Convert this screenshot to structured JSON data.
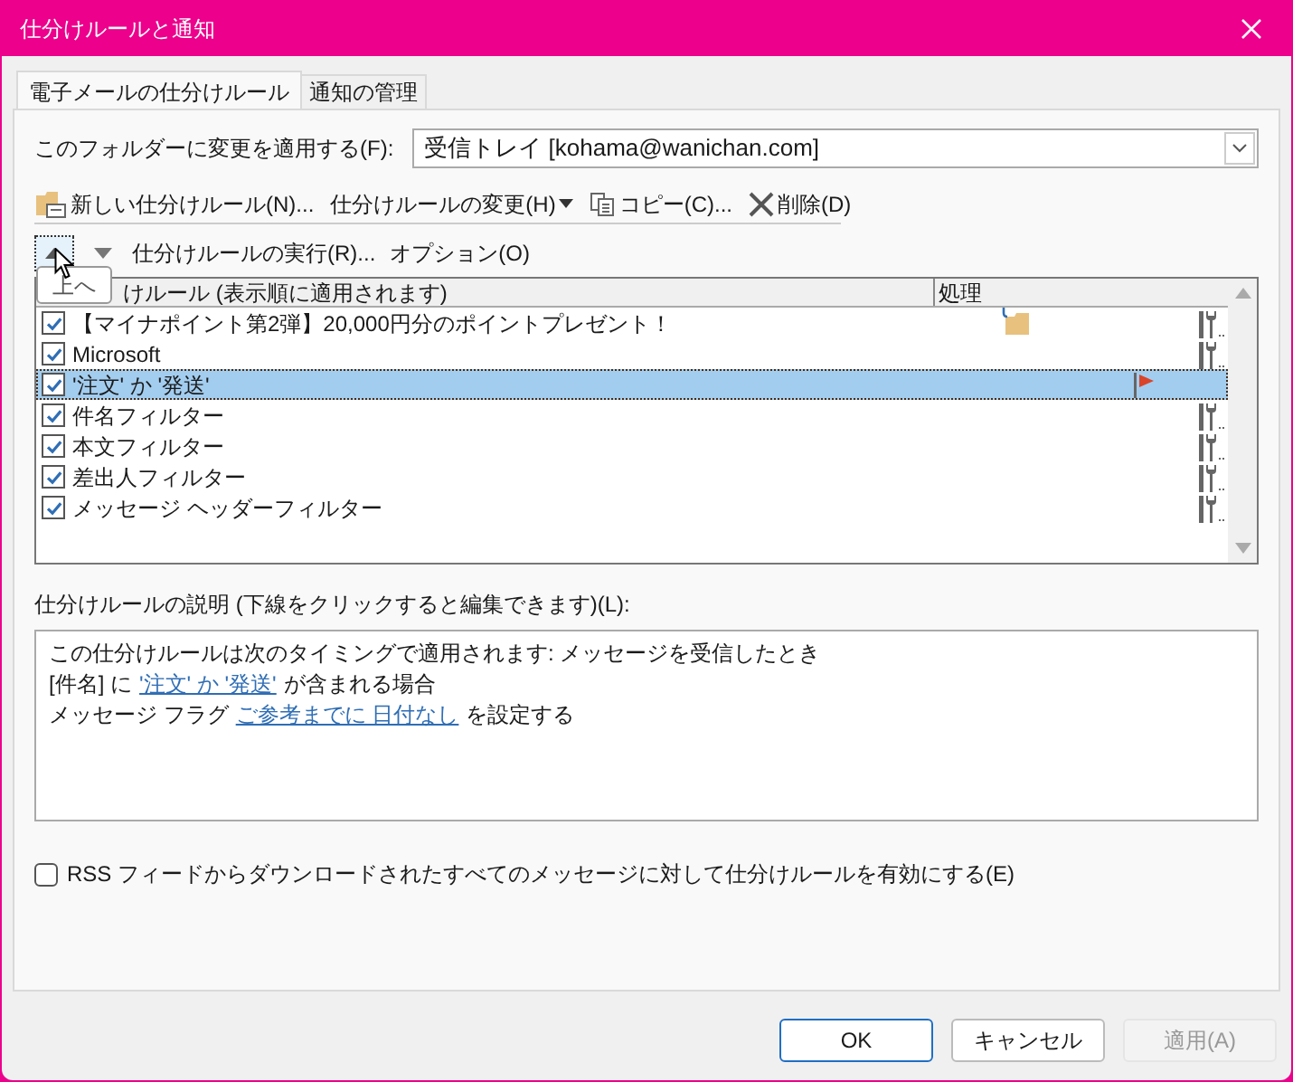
{
  "window": {
    "title": "仕分けルールと通知"
  },
  "tabs": [
    {
      "label": "電子メールの仕分けルール",
      "selected": true
    },
    {
      "label": "通知の管理",
      "selected": false
    }
  ],
  "folder": {
    "label": "このフォルダーに変更を適用する(F):",
    "value": "受信トレイ [kohama@wanichan.com]"
  },
  "toolbar": [
    {
      "kind": "new",
      "label": "新しい仕分けルール(N)..."
    },
    {
      "kind": "change",
      "label": "仕分けルールの変更(H)"
    },
    {
      "kind": "copy",
      "label": "コピー(C)..."
    },
    {
      "kind": "delete",
      "label": "削除(D)"
    }
  ],
  "toolbar2": {
    "run": "仕分けルールの実行(R)...",
    "options": "オプション(O)"
  },
  "tooltip": "上へ",
  "table": {
    "columns": [
      "けルール (表示順に適用されます)",
      "処理"
    ],
    "rows": [
      {
        "name": "【マイナポイント第2弾】20,000円分のポイントプレゼント！",
        "checked": true,
        "selected": false,
        "actions": [
          {
            "kind": "move"
          },
          {
            "kind": "custom"
          }
        ]
      },
      {
        "name": "Microsoft",
        "checked": true,
        "selected": false,
        "actions": [
          {
            "kind": "custom"
          }
        ]
      },
      {
        "name": "'注文' か '発送'",
        "checked": true,
        "selected": true,
        "actions": [
          {
            "kind": "flag"
          }
        ]
      },
      {
        "name": "件名フィルター",
        "checked": true,
        "selected": false,
        "actions": [
          {
            "kind": "custom"
          }
        ]
      },
      {
        "name": "本文フィルター",
        "checked": true,
        "selected": false,
        "actions": [
          {
            "kind": "custom"
          }
        ]
      },
      {
        "name": "差出人フィルター",
        "checked": true,
        "selected": false,
        "actions": [
          {
            "kind": "custom"
          }
        ]
      },
      {
        "name": "メッセージ ヘッダーフィルター",
        "checked": true,
        "selected": false,
        "actions": [
          {
            "kind": "custom"
          }
        ]
      }
    ]
  },
  "description": {
    "label": "仕分けルールの説明 (下線をクリックすると編集できます)(L):",
    "lines": [
      [
        {
          "kind": "text",
          "text": "この仕分けルールは次のタイミングで適用されます: メッセージを受信したとき"
        }
      ],
      [
        {
          "kind": "text",
          "text": "[件名] に"
        },
        {
          "kind": "link",
          "text": "'注文' か '発送'"
        },
        {
          "kind": "text",
          "text": "が含まれる場合"
        }
      ],
      [
        {
          "kind": "text",
          "text": "メッセージ フラグ"
        },
        {
          "kind": "link",
          "text": "ご参考までに 日付なし"
        },
        {
          "kind": "text",
          "text": "を設定する"
        }
      ]
    ]
  },
  "rss": {
    "label": "RSS フィードからダウンロードされたすべてのメッセージに対して仕分けルールを有効にする(E)",
    "checked": false
  },
  "buttons": [
    {
      "label": "OK",
      "default": true,
      "disabled": false
    },
    {
      "label": "キャンセル",
      "default": false,
      "disabled": false
    },
    {
      "label": "適用(A)",
      "default": false,
      "disabled": true
    }
  ]
}
